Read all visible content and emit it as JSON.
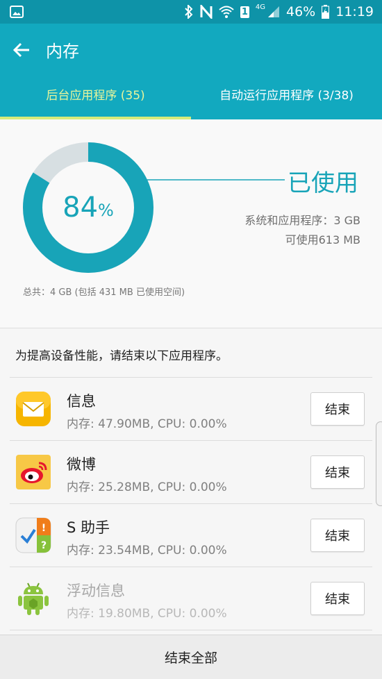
{
  "status_bar": {
    "battery": "46%",
    "time": "11:19",
    "network": "4G",
    "sim": "1",
    "icons": [
      "image-icon",
      "bluetooth-icon",
      "nfc-icon",
      "wifi-icon",
      "sim-icon",
      "signal-icon",
      "battery-charging-icon"
    ]
  },
  "header": {
    "title": "内存",
    "tabs": [
      {
        "label": "后台应用程序 (35)",
        "active": true
      },
      {
        "label": "自动运行应用程序 (3/38)",
        "active": false
      }
    ]
  },
  "usage": {
    "percent_value": "84",
    "percent_sign": "%",
    "percent": 84,
    "used_label": "已使用",
    "system_apps": "系统和应用程序：3 GB",
    "available": "可使用613 MB",
    "total": "总共：4 GB (包括 431 MB 已使用空间)"
  },
  "hint": "为提高设备性能，请结束以下应用程序。",
  "apps": [
    {
      "name": "信息",
      "stats": "内存: 47.90MB, CPU: 0.00%",
      "button": "结束",
      "icon": "message-icon"
    },
    {
      "name": "微博",
      "stats": "内存: 25.28MB, CPU: 0.00%",
      "button": "结束",
      "icon": "weibo-icon"
    },
    {
      "name": "S 助手",
      "stats": "内存: 23.54MB, CPU: 0.00%",
      "button": "结束",
      "icon": "s-assistant-icon"
    },
    {
      "name": "浮动信息",
      "stats": "内存: 19.80MB, CPU: 0.00%",
      "button": "结束",
      "icon": "android-icon"
    }
  ],
  "bottom_button": "结束全部",
  "colors": {
    "statusbar": "#0e93a8",
    "appbar": "#12a9bf",
    "accent": "#18a4b8",
    "tab_active": "#e9f59b",
    "donut_remaining": "#d7dfe2"
  }
}
